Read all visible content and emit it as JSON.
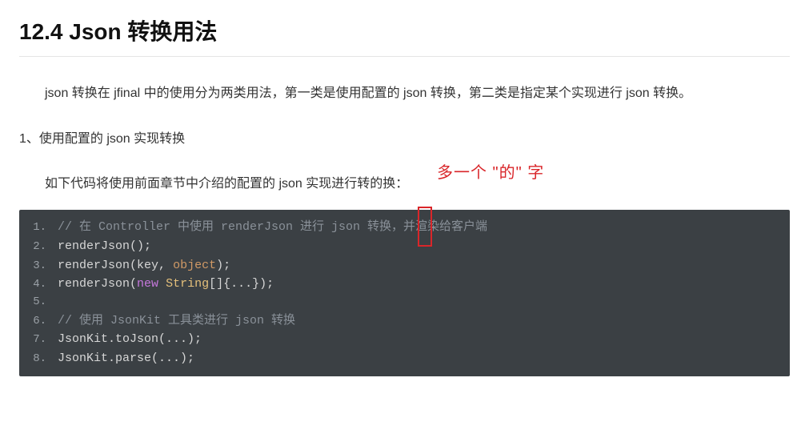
{
  "title": "12.4 Json 转换用法",
  "intro": "json 转换在 jfinal 中的使用分为两类用法，第一类是使用配置的 json 转换，第二类是指定某个实现进行 json 转换。",
  "subheading": "1、使用配置的 json 实现转换",
  "para2": "如下代码将使用前面章节中介绍的配置的 json 实现进行转的换：",
  "annotation": {
    "text": "多一个 \"的\" 字"
  },
  "code": {
    "l1_comment": "// 在 Controller 中使用 renderJson 进行 json 转换，并渲染给客户端",
    "l2_fn": "renderJson",
    "l3_fn": "renderJson",
    "l3_arg1": "key",
    "l3_arg2": "object",
    "l4_fn": "renderJson",
    "l4_kw": "new",
    "l4_cls": "String",
    "l6_comment": "// 使用 JsonKit 工具类进行 json 转换",
    "l7": "JsonKit.toJson(...);",
    "l8": "JsonKit.parse(...);"
  }
}
